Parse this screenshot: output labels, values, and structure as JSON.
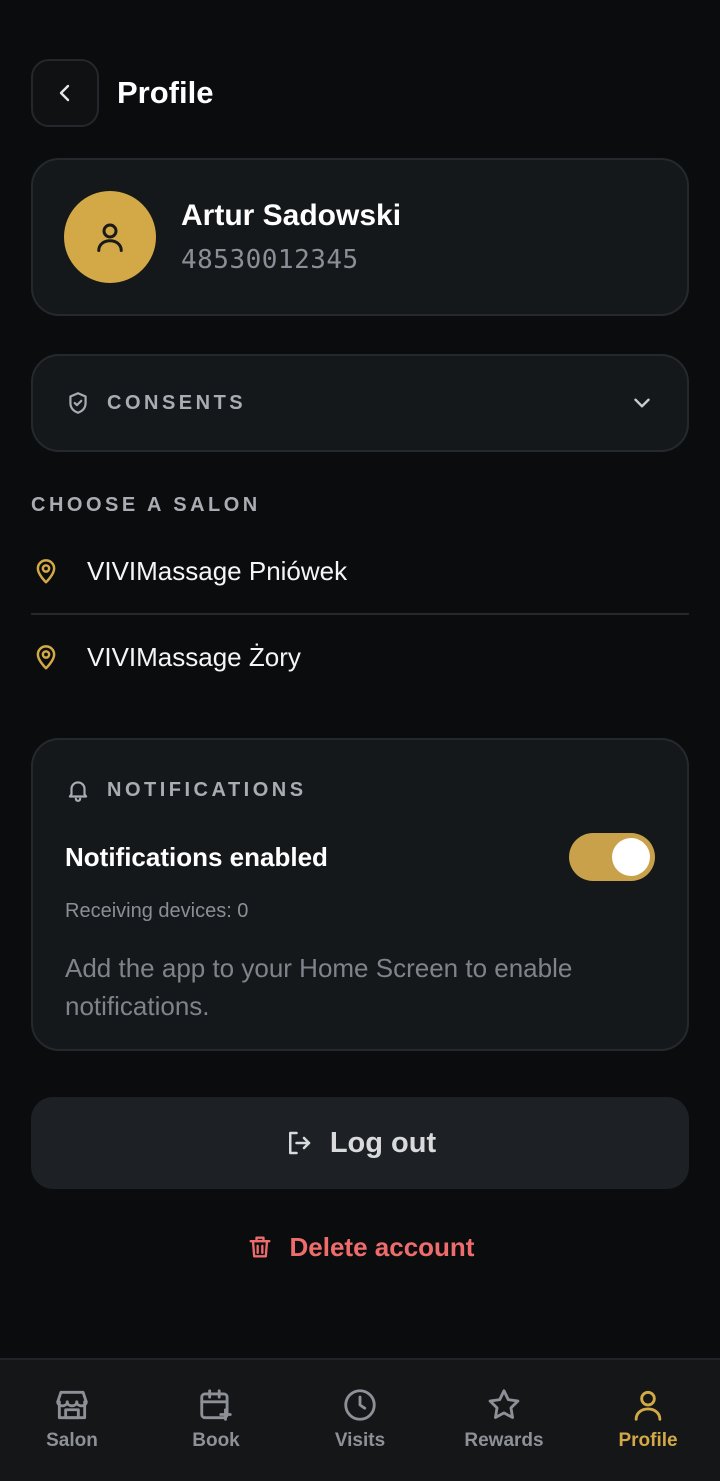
{
  "header": {
    "title": "Profile"
  },
  "profile": {
    "name": "Artur Sadowski",
    "phone": "48530012345"
  },
  "consents": {
    "label": "CONSENTS"
  },
  "salons": {
    "label": "CHOOSE A SALON",
    "items": [
      {
        "name": "VIVIMassage Pniówek"
      },
      {
        "name": "VIVIMassage Żory"
      }
    ]
  },
  "notifications": {
    "label": "NOTIFICATIONS",
    "title": "Notifications enabled",
    "enabled": true,
    "devices": "Receiving devices: 0",
    "hint": "Add the app to your Home Screen to enable notifications."
  },
  "actions": {
    "logout": "Log out",
    "delete": "Delete account"
  },
  "nav": {
    "items": [
      {
        "label": "Salon",
        "icon": "store-icon"
      },
      {
        "label": "Book",
        "icon": "calendar-plus-icon"
      },
      {
        "label": "Visits",
        "icon": "clock-icon"
      },
      {
        "label": "Rewards",
        "icon": "star-icon"
      },
      {
        "label": "Profile",
        "icon": "user-icon",
        "active": true
      }
    ]
  },
  "colors": {
    "accent": "#d3a847",
    "danger": "#ef6c6c",
    "background": "#0b0c0d",
    "card": "#15181b"
  }
}
